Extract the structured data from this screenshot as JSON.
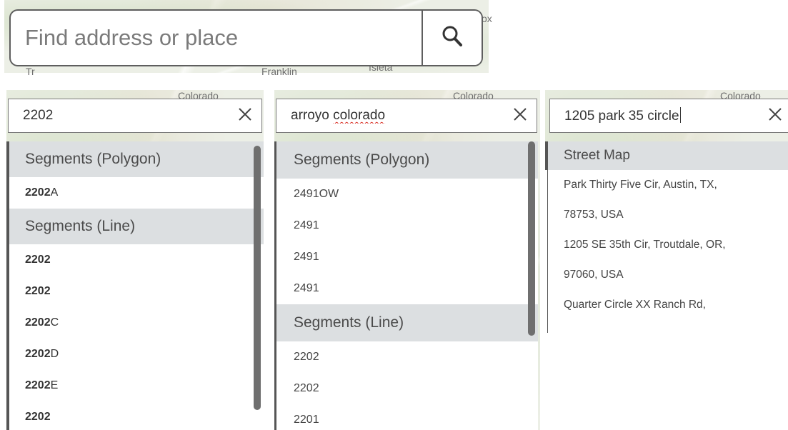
{
  "top_search": {
    "placeholder": "Find address or place",
    "map_labels": [
      "Isleta",
      "Franklin",
      "Tr",
      "ox"
    ]
  },
  "panels": [
    {
      "query": "2202",
      "map_labels": [
        "Colorado"
      ],
      "groups": [
        {
          "header": "Segments (Polygon)",
          "items": [
            {
              "bold": "2202",
              "rest": "A"
            }
          ]
        },
        {
          "header": "Segments (Line)",
          "items": [
            {
              "bold": "2202",
              "rest": ""
            },
            {
              "bold": "2202",
              "rest": ""
            },
            {
              "bold": "2202",
              "rest": "C"
            },
            {
              "bold": "2202",
              "rest": "D"
            },
            {
              "bold": "2202",
              "rest": "E"
            },
            {
              "bold": "2202",
              "rest": ""
            }
          ]
        }
      ]
    },
    {
      "query_prefix": "arroyo ",
      "query_misspelled": "colorado",
      "map_labels": [
        "Colorado"
      ],
      "groups": [
        {
          "header": "Segments (Polygon)",
          "items": [
            "2491OW",
            "2491",
            "2491",
            "2491"
          ]
        },
        {
          "header": "Segments (Line)",
          "items": [
            "2202",
            "2202",
            "2201"
          ]
        }
      ]
    },
    {
      "query": "1205 park 35 circle",
      "map_labels": [
        "Colorado"
      ],
      "groups": [
        {
          "header": "Street Map",
          "items": [
            "Park Thirty Five Cir, Austin, TX,",
            "78753, USA",
            "1205 SE 35th Cir, Troutdale, OR,",
            "97060, USA",
            "Quarter Circle XX Ranch Rd,"
          ]
        }
      ]
    }
  ],
  "colors": {
    "header_bg": "#dcdfe1",
    "border": "#5e5e5e",
    "map_bg": "#ecefe6"
  },
  "icons": [
    "search-icon",
    "close-icon"
  ]
}
